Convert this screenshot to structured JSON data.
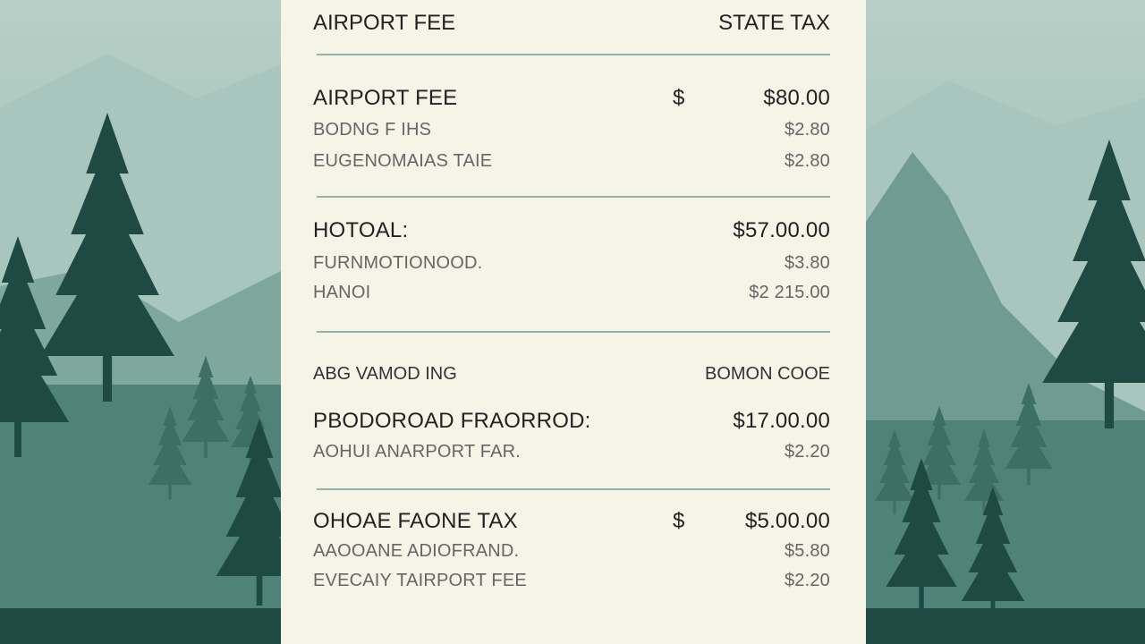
{
  "colors": {
    "card_bg": "#f6f3e7",
    "divider": "#92b4a6",
    "text_major": "#222222",
    "text_minor": "#666666"
  },
  "header": {
    "left": "AIRPORT FEE",
    "right": "STATE TAX"
  },
  "sections": [
    {
      "main": {
        "label": "AIRPORT FEE",
        "currency": "$",
        "amount": "$80.00"
      },
      "lines": [
        {
          "label": "BODNG F IHS",
          "amount": "$2.80"
        },
        {
          "label": "EUGENOMAIAS TAIE",
          "amount": "$2.80"
        }
      ]
    },
    {
      "main": {
        "label": "HOTOAL:",
        "currency": "",
        "amount": "$57.00.00"
      },
      "lines": [
        {
          "label": "FURNMOTIONOOD.",
          "amount": "$3.80"
        },
        {
          "label": "HANOI",
          "amount": "$2 215.00"
        }
      ]
    },
    {
      "subhead": {
        "label": "ABG VAMOD ING",
        "right": "BOMON COOE"
      },
      "main": {
        "label": "PBODOROAD FRAORROD:",
        "currency": "",
        "amount": "$17.00.00"
      },
      "lines": [
        {
          "label": "AOHUI ANARPORT FAR.",
          "amount": "$2.20"
        }
      ]
    },
    {
      "main": {
        "label": "OHOAE FAONE TAX",
        "currency": "$",
        "amount": "$5.00.00"
      },
      "lines": [
        {
          "label": "AAOOANE ADIOFRAND.",
          "amount": "$5.80"
        },
        {
          "label": "EVECAIY TAIRPORT FEE",
          "amount": "$2.20"
        }
      ]
    }
  ]
}
